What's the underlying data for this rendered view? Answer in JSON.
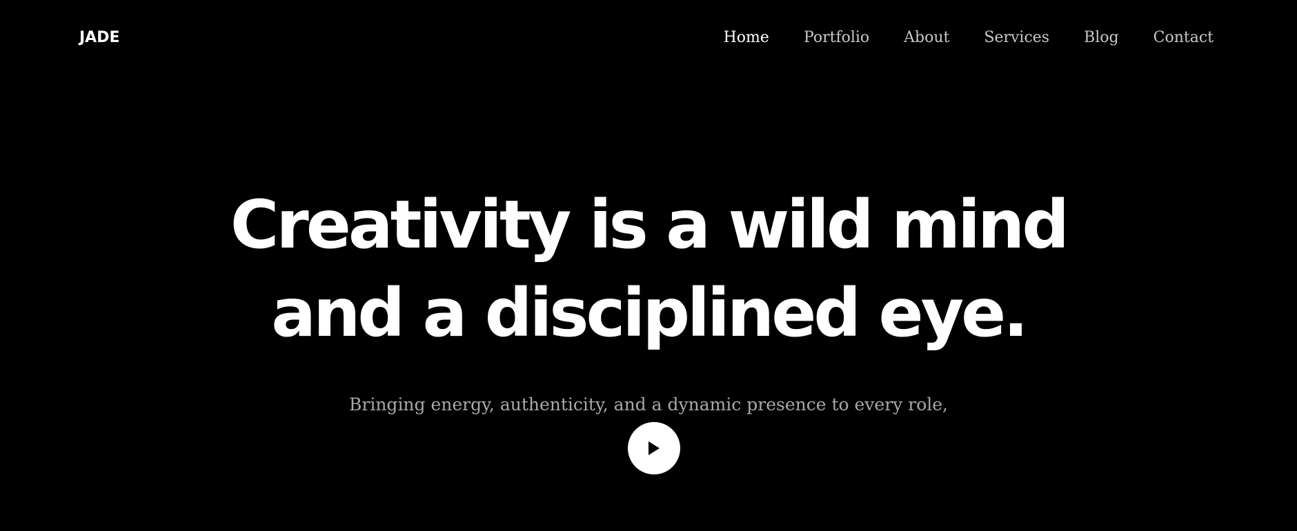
{
  "header": {
    "logo": "JADE",
    "nav": [
      {
        "label": "Home",
        "active": true
      },
      {
        "label": "Portfolio",
        "active": false
      },
      {
        "label": "About",
        "active": false
      },
      {
        "label": "Services",
        "active": false
      },
      {
        "label": "Blog",
        "active": false
      },
      {
        "label": "Contact",
        "active": false
      }
    ]
  },
  "hero": {
    "headline_line1": "Creativity is a wild mind",
    "headline_line2": "and a disciplined eye.",
    "subtitle": "Bringing energy, authenticity, and a dynamic presence to every role,",
    "play_icon": "play-icon"
  },
  "colors": {
    "background": "#000000",
    "text": "#ffffff",
    "nav_inactive": "#c9c9c9",
    "subtitle": "#a9a9a9"
  }
}
